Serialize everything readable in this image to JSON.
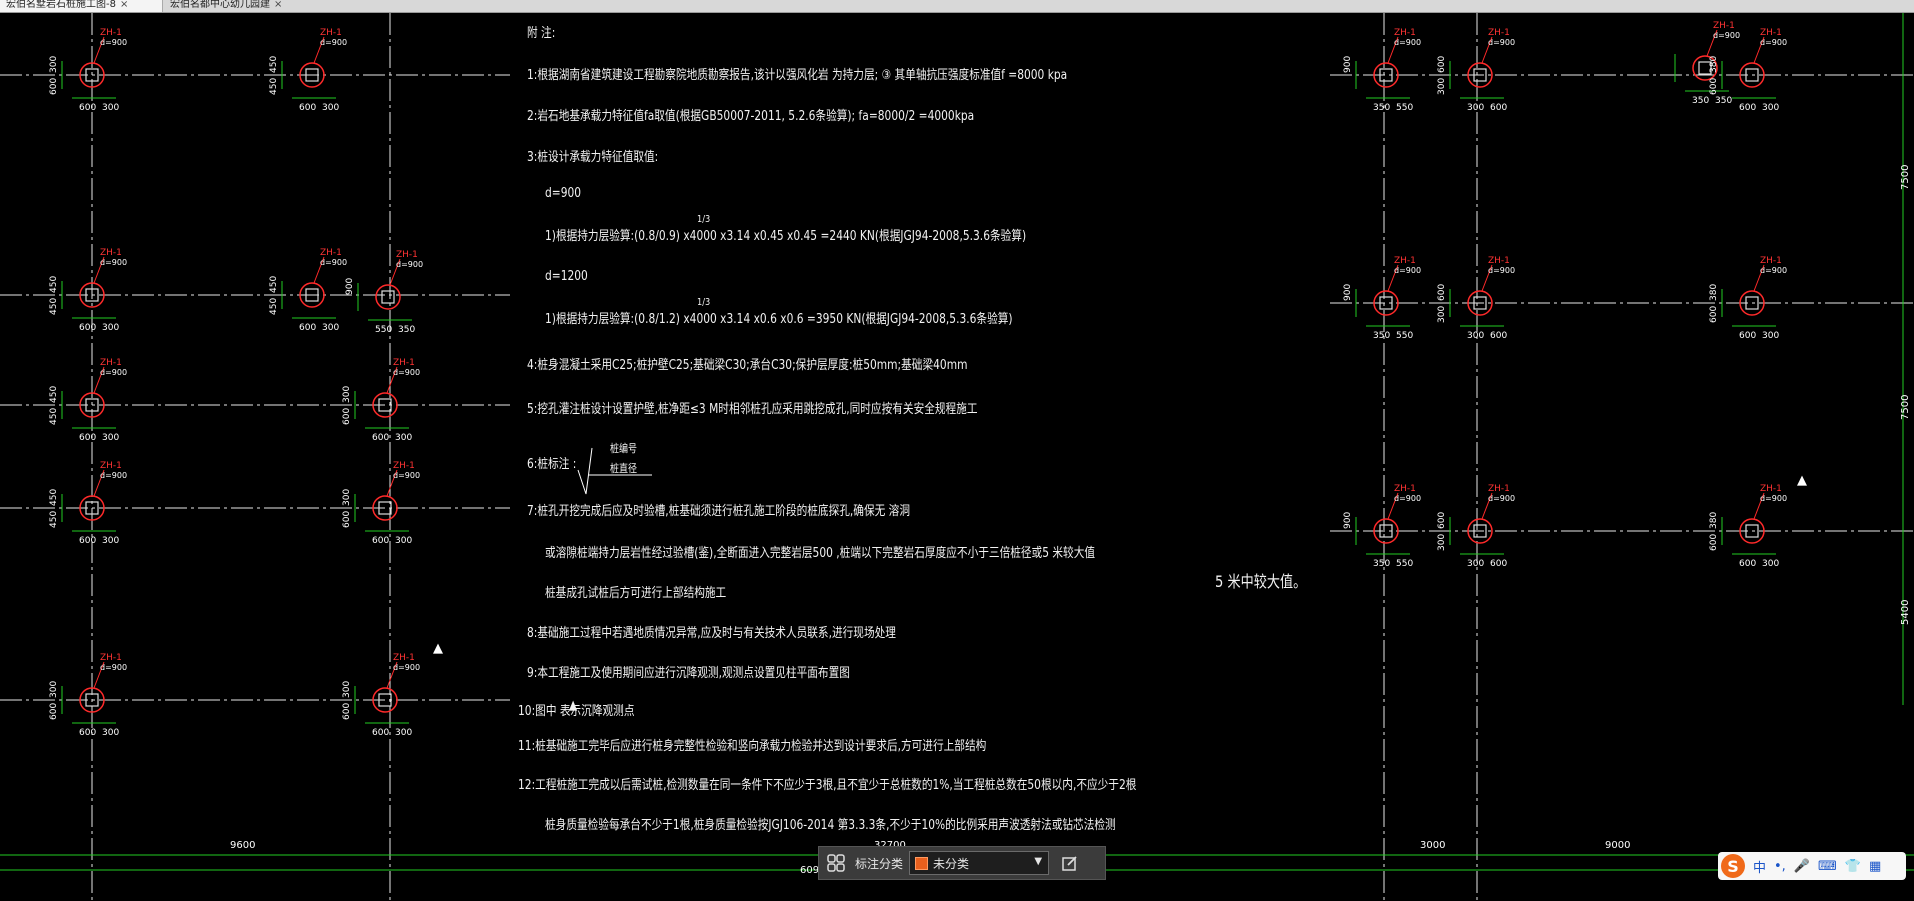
{
  "window": {
    "tabs": [
      {
        "label": "宏伯名墅岩石桩施工图-8",
        "close": "×"
      },
      {
        "label": "宏伯名都中心幼儿园建",
        "close": "×"
      }
    ]
  },
  "drawing": {
    "piles": [
      {
        "tag": "ZH-1",
        "dia": "d=900",
        "dims": [
          "600",
          "300",
          "300",
          "600"
        ]
      },
      {
        "tag": "ZH-1",
        "dia": "d=900",
        "dims": [
          "600",
          "300",
          "450",
          "450"
        ]
      },
      {
        "tag": "ZH-1",
        "dia": "d=900",
        "dims": [
          "550",
          "350",
          "900"
        ]
      },
      {
        "tag": "ZH-1",
        "dia": "d=900",
        "dims": [
          "350",
          "550",
          "900"
        ]
      },
      {
        "tag": "ZH-1",
        "dia": "d=900",
        "dims": [
          "300",
          "600",
          "600",
          "300"
        ]
      },
      {
        "tag": "ZH-1",
        "dia": "d=900",
        "dims": [
          "350",
          "350"
        ]
      },
      {
        "tag": "ZH-1",
        "dia": "d=900",
        "dims": [
          "600",
          "300",
          "380",
          "600"
        ]
      }
    ],
    "dim_labels": [
      "7500",
      "7500",
      "5400",
      "9600",
      "32700",
      "3000",
      "9000",
      "609"
    ],
    "marker_glyph": "▲",
    "side_note": "5 米中较大值。"
  },
  "notes": {
    "title": "附 注:",
    "lines": [
      "1:根据湖南省建筑建设工程勘察院地质勘察报告,该计以强风化岩    为持力层;  ③          其单轴抗压强度标准值f =8000 kpa",
      "2:岩石地基承载力特征值fa取值(根据GB50007-2011, 5.2.6条验算);                    fa=8000/2 =4000kpa",
      "3:桩设计承载力特征值取值:",
      "d=900",
      "1)根据持力层验算:(0.8/0.9)      x4000 x3.14 x0.45 x0.45 =2440 KN(根据JGJ94-2008,5.3.6条验算)",
      "d=1200",
      "1)根据持力层验算:(0.8/1.2)      x4000 x3.14 x0.6 x0.6 =3950 KN(根据JGJ94-2008,5.3.6条验算)",
      "4:桩身混凝土采用C25;桩护壁C25;基础梁C30;承台C30;保护层厚度:桩50mm;基础梁40mm",
      "5:挖孔灌注桩设计设置护壁,桩净距≤3 M时相邻桩孔应采用跳挖成孔,同时应按有关安全规程施工",
      "6:桩标注      :",
      "7:桩孔开挖完成后应及时验槽,桩基础须进行桩孔施工阶段的桩底探孔,确保无 溶洞",
      "或溶隙桩端持力层岩性经过验槽(鉴),全断面进入完整岩层500 ,桩端以下完整岩石厚度应不小于三倍桩径或5 米较大值",
      "桩基成孔试桩后方可进行上部结构施工",
      "8:基础施工过程中若遇地质情况异常,应及时与有关技术人员联系,进行现场处理",
      "9:本工程施工及使用期间应进行沉降观测,观测点设置见柱平面布置图",
      "10:图中    表示沉降观测点",
      "11:桩基础施工完毕后应进行桩身完整性检验和竖向承载力检验并达到设计要求后,方可进行上部结构",
      "12:工程桩施工完成以后需试桩,检测数量在同一条件下不应少于3根,且不宜少于总桩数的1%,当工程桩总数在50根以内,不应少于2根",
      "桩身质量检验每承台不少于1根,桩身质量检验按JGJ106-2014 第3.3.3条,不少于10%的比例采用声波透射法或钻芯法检测"
    ],
    "exp": "1/3",
    "fraction_top": "桩编号",
    "fraction_bottom": "桩直径"
  },
  "annotation_bar": {
    "label": "标注分类",
    "selected": "未分类",
    "swatch_color": "#e8601e"
  },
  "ime": {
    "logo": "S",
    "items": [
      "中",
      "•,",
      "🎤",
      "⌨",
      "👕",
      "▦"
    ]
  },
  "colors": {
    "grid": "#e8e8e8",
    "pile_circle": "#ff2a2a",
    "dimension": "#22cc22",
    "tag": "#ff3333",
    "text": "#f2f2f2"
  }
}
